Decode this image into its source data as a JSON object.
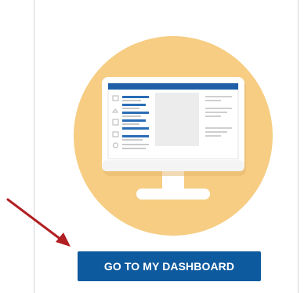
{
  "cta": {
    "label": "GO TO MY DASHBOARD"
  },
  "illustration": {
    "icon": "monitor-dashboard-icon",
    "circle_color": "#f6cd82",
    "monitor_frame_color": "#ffffff",
    "screen_header_color": "#1f5fa8"
  },
  "arrow": {
    "icon": "arrow-pointer-icon",
    "color": "#b11f22"
  },
  "colors": {
    "button_bg": "#0e5a9e",
    "button_text": "#ffffff",
    "card_border": "#d4d4d4"
  }
}
